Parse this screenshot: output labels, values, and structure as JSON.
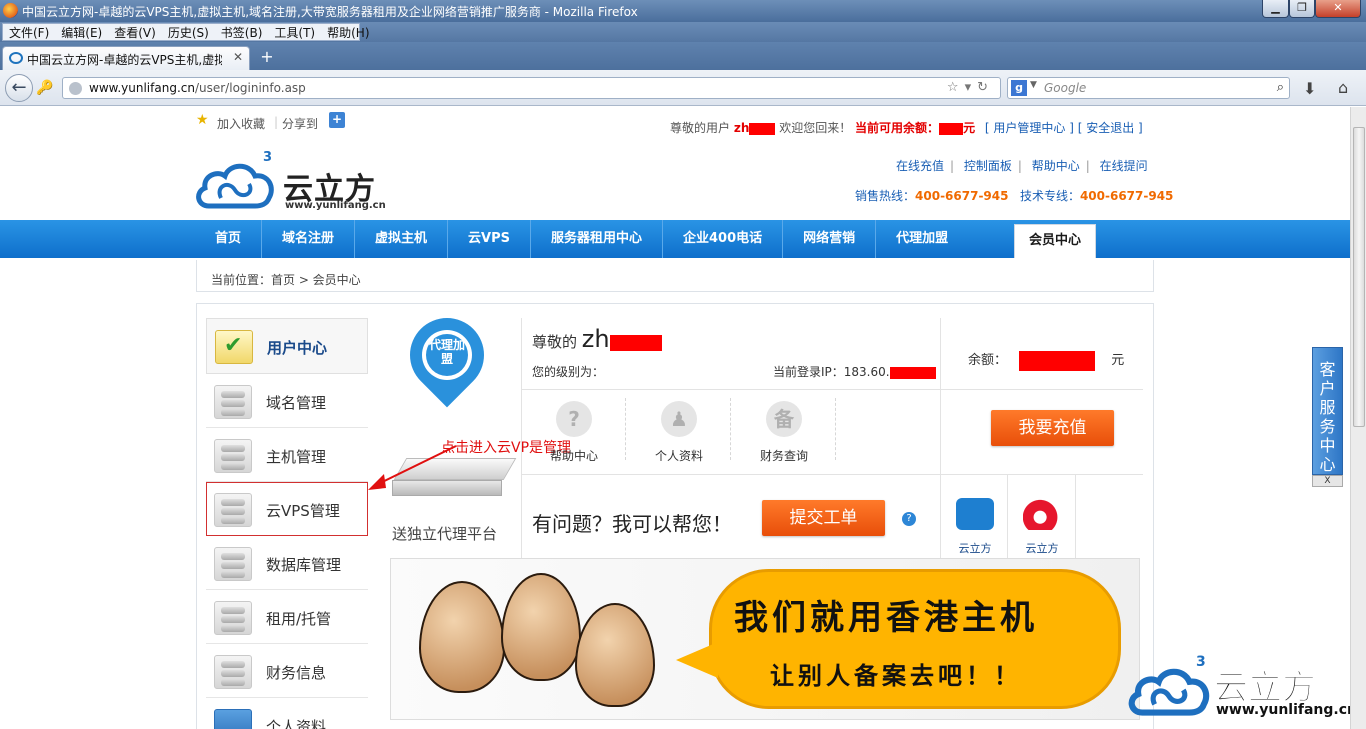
{
  "browser": {
    "window_title": "中国云立方网-卓越的云VPS主机,虚拟主机,域名注册,大带宽服务器租用及企业网络营销推广服务商 - Mozilla Firefox",
    "minimize": "▁",
    "maximize": "❐",
    "close": "✕",
    "menus": [
      "文件(F)",
      "编辑(E)",
      "查看(V)",
      "历史(S)",
      "书签(B)",
      "工具(T)",
      "帮助(H)"
    ],
    "tab_title": "中国云立方网-卓越的云VPS主机,虚拟主...",
    "tab_close": "✕",
    "new_tab": "+",
    "url_host": "www.yunlifang.cn",
    "url_path": "/user/logininfo.asp",
    "search_placeholder": "Google",
    "search_engine_letter": "g"
  },
  "site": {
    "favorite": "加入收藏",
    "share": "分享到",
    "welcome_prefix": "尊敬的用户",
    "username_visible": "zh",
    "welcome_back": "欢迎您回来！",
    "balance_label": "当前可用余额：",
    "balance_unit": "元",
    "user_center_link": "[ 用户管理中心 ]",
    "logout_link": "[ 安全退出 ]",
    "logo_brand": "云立方",
    "logo_sup": "3",
    "logo_domain": "www.yunlifang.cn",
    "quicklinks": [
      "在线充值",
      "控制面板",
      "帮助中心",
      "在线提问"
    ],
    "sales_label": "销售热线：",
    "sales_phone": "400-6677-945",
    "tech_label": "技术专线：",
    "tech_phone": "400-6677-945",
    "nav": [
      "首页",
      "域名注册",
      "虚拟主机",
      "云VPS",
      "服务器租用中心",
      "企业400电话",
      "网络营销",
      "代理加盟"
    ],
    "nav_active": "会员中心",
    "breadcrumb": "当前位置：首页 > 会员中心"
  },
  "sidebar": {
    "header": "用户中心",
    "items": [
      "域名管理",
      "主机管理",
      "云VPS管理",
      "数据库管理",
      "租用/托管",
      "财务信息",
      "个人资料"
    ],
    "selected_index": 2
  },
  "agent": {
    "pin_text": "代理加盟",
    "caption": "送独立代理平台",
    "annotation": "点击进入云VP是管理"
  },
  "account": {
    "greet": "尊敬的",
    "name_visible": "zh",
    "level_label": "您的级别为：",
    "ip_label": "当前登录IP：",
    "ip_visible": "183.60.",
    "balance_label": "余额：",
    "balance_unit": "元",
    "quick_icons": [
      {
        "label": "帮助中心",
        "glyph": "?"
      },
      {
        "label": "个人资料",
        "glyph": "♟"
      },
      {
        "label": "财务查询",
        "glyph": "备"
      }
    ],
    "recharge_button": "我要充值",
    "help_text": "有问题？我可以帮您！",
    "ticket_button": "提交工单",
    "help_glyph": "?",
    "social": [
      "云立方",
      "云立方"
    ]
  },
  "banner": {
    "line1": "我们就用香港主机",
    "line2": "让别人备案去吧！！"
  },
  "watermark": {
    "brand": "云立方",
    "sup": "3",
    "domain": "www.yunlifang.cn"
  },
  "customer_service": {
    "label": "客户服务中心",
    "close": "X"
  },
  "colors": {
    "nav_blue": "#0e6fcb",
    "accent_orange": "#e84e09",
    "link_blue": "#1a5fb4",
    "redaction": "#ff0000"
  }
}
